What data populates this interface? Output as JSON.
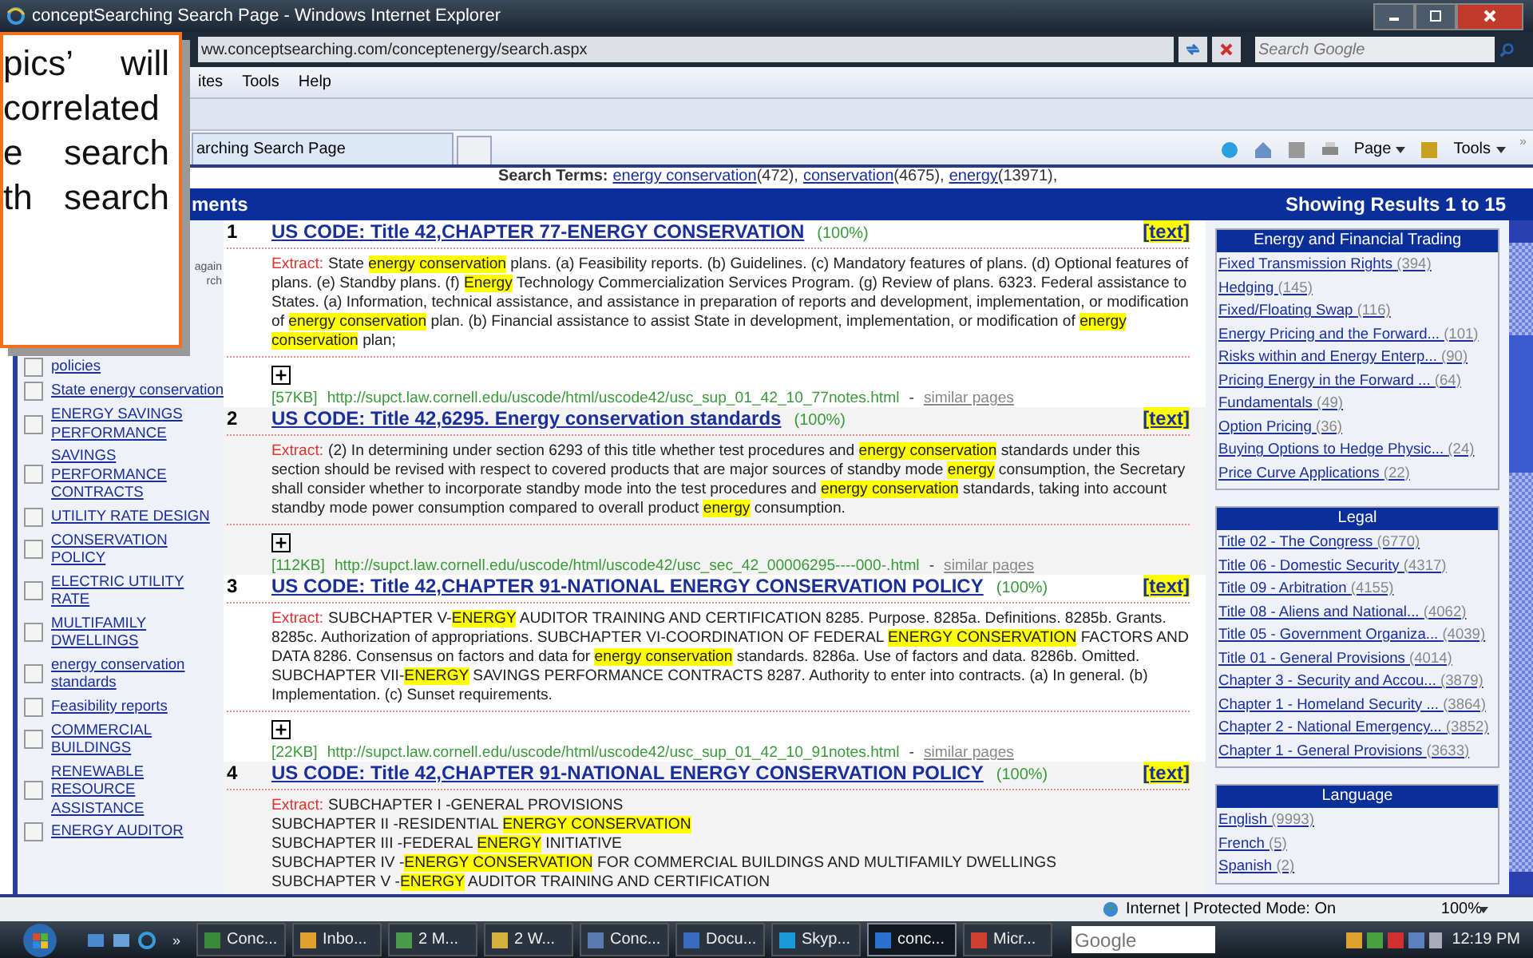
{
  "callout": {
    "lines": [
      "pics’ will",
      "correlated",
      "e search",
      "th search"
    ]
  },
  "window": {
    "title": "conceptSearching Search Page - Windows Internet Explorer"
  },
  "address_bar": {
    "url": "ww.conceptsearching.com/conceptenergy/search.aspx",
    "search_placeholder": "Search Google"
  },
  "menu": [
    "ites",
    "Tools",
    "Help"
  ],
  "tabs": [
    {
      "label": "arching Search Page",
      "selected": true
    }
  ],
  "command_bar": {
    "page": "Page",
    "tools": "Tools",
    "more": "»"
  },
  "search_terms": {
    "label": "Search Terms:",
    "terms": [
      {
        "term": "energy conservation",
        "count": "(472),"
      },
      {
        "term": "conservation",
        "count": "(4675),"
      },
      {
        "term": "energy",
        "count": "(13971),"
      }
    ]
  },
  "results_header": {
    "left": "ments",
    "right": "Showing Results 1 to 15"
  },
  "sidebar": {
    "note": [
      "again",
      "rch"
    ],
    "items": [
      {
        "label": "policies",
        "checked": false
      },
      {
        "label": "State energy conservation",
        "checked": false
      },
      {
        "label": "ENERGY SAVINGS PERFORMANCE",
        "checked": false
      },
      {
        "label": "SAVINGS PERFORMANCE CONTRACTS",
        "checked": false
      },
      {
        "label": "UTILITY RATE DESIGN",
        "checked": false
      },
      {
        "label": "CONSERVATION POLICY",
        "checked": false
      },
      {
        "label": "ELECTRIC UTILITY RATE",
        "checked": false
      },
      {
        "label": "MULTIFAMILY DWELLINGS",
        "checked": false
      },
      {
        "label": "energy conservation standards",
        "checked": false
      },
      {
        "label": "Feasibility reports",
        "checked": false
      },
      {
        "label": "COMMERCIAL BUILDINGS",
        "checked": false
      },
      {
        "label": "RENEWABLE RESOURCE ASSISTANCE",
        "checked": false
      },
      {
        "label": "ENERGY AUDITOR",
        "checked": false
      }
    ]
  },
  "results": [
    {
      "number": "1",
      "title": "US CODE: Title 42,CHAPTER 77-ENERGY CONSERVATION",
      "score": "(100%)",
      "text_link": "[text]",
      "extract_label": "Extract:",
      "extract": [
        "State **energy conservation** plans. (a) Feasibility reports. (b) Guidelines. (c) Mandatory features of plans. (d) Optional features of plans. (e) Standby plans. (f) **Energy** Technology Commercialization Services Program. (g) Review of plans. 6323. Federal assistance to States. (a) Information, technical assistance, and assistance in preparation of reports and development, implementation, or modification of **energy conservation** plan. (b) Financial assistance to assist State in development, implementation, or modification of **energy conservation** plan;"
      ],
      "size": "[57KB]",
      "url": "http://supct.law.cornell.edu/uscode/html/uscode42/usc_sup_01_42_10_77notes.html",
      "dash": "-",
      "similar": "similar pages"
    },
    {
      "number": "2",
      "title": "US CODE: Title 42,6295. Energy conservation standards",
      "score": "(100%)",
      "text_link": "[text]",
      "extract_label": "Extract:",
      "extract": [
        "(2) In determining under section 6293 of this title whether test procedures and **energy conservation** standards under this section should be revised with respect to covered products that are major sources of standby mode **energy** consumption, the Secretary shall consider whether to incorporate standby mode into the test procedures and **energy conservation** standards, taking into account standby mode power consumption compared to overall product **energy** consumption."
      ],
      "size": "[112KB]",
      "url": "http://supct.law.cornell.edu/uscode/html/uscode42/usc_sec_42_00006295----000-.html",
      "dash": "-",
      "similar": "similar pages"
    },
    {
      "number": "3",
      "title": "US CODE: Title 42,CHAPTER 91-NATIONAL ENERGY CONSERVATION POLICY",
      "score": "(100%)",
      "text_link": "[text]",
      "extract_label": "Extract:",
      "extract": [
        "SUBCHAPTER V-**ENERGY** AUDITOR TRAINING AND CERTIFICATION 8285. Purpose. 8285a. Definitions. 8285b. Grants. 8285c. Authorization of appropriations. SUBCHAPTER VI-COORDINATION OF FEDERAL **ENERGY CONSERVATION** FACTORS AND DATA 8286. Consensus on factors and data for **energy conservation** standards. 8286a. Use of factors and data. 8286b. Omitted. SUBCHAPTER VII-**ENERGY** SAVINGS PERFORMANCE CONTRACTS 8287. Authority to enter into contracts. (a) In general. (b) Implementation. (c) Sunset requirements."
      ],
      "size": "[22KB]",
      "url": "http://supct.law.cornell.edu/uscode/html/uscode42/usc_sup_01_42_10_91notes.html",
      "dash": "-",
      "similar": "similar pages"
    },
    {
      "number": "4",
      "title": "US CODE: Title 42,CHAPTER 91-NATIONAL ENERGY CONSERVATION POLICY",
      "score": "(100%)",
      "text_link": "[text]",
      "extract_label": "Extract:",
      "extract": [
        "SUBCHAPTER I -GENERAL PROVISIONS",
        "SUBCHAPTER II -RESIDENTIAL **ENERGY CONSERVATION**",
        "SUBCHAPTER III -FEDERAL **ENERGY** INITIATIVE",
        "SUBCHAPTER IV -**ENERGY CONSERVATION** FOR COMMERCIAL BUILDINGS AND MULTIFAMILY DWELLINGS",
        "SUBCHAPTER V -**ENERGY** AUDITOR TRAINING AND CERTIFICATION"
      ]
    }
  ],
  "facets": [
    {
      "title": "Energy and Financial Trading",
      "items": [
        {
          "label": "Fixed Transmission Rights",
          "count": "(394)"
        },
        {
          "label": "Hedging",
          "count": "(145)"
        },
        {
          "label": "Fixed/Floating Swap",
          "count": "(116)"
        },
        {
          "label": "Energy Pricing and the Forward...",
          "count": "(101)"
        },
        {
          "label": "Risks within and Energy Enterp...",
          "count": "(90)"
        },
        {
          "label": "Pricing Energy in the Forward ...",
          "count": "(64)"
        },
        {
          "label": "Fundamentals",
          "count": "(49)"
        },
        {
          "label": "Option Pricing",
          "count": "(36)"
        },
        {
          "label": "Buying Options to Hedge Physic...",
          "count": "(24)"
        },
        {
          "label": "Price Curve Applications",
          "count": "(22)"
        }
      ]
    },
    {
      "title": "Legal",
      "items": [
        {
          "label": "Title 02 - The Congress",
          "count": "(6770)"
        },
        {
          "label": "Title 06 - Domestic Security",
          "count": "(4317)"
        },
        {
          "label": "Title 09 - Arbitration",
          "count": "(4155)"
        },
        {
          "label": "Title 08 - Aliens and National...",
          "count": "(4062)"
        },
        {
          "label": "Title 05 - Government Organiza...",
          "count": "(4039)"
        },
        {
          "label": "Title 01 - General Provisions",
          "count": "(4014)"
        },
        {
          "label": "Chapter 3 - Security and Accou...",
          "count": "(3879)"
        },
        {
          "label": "Chapter 1 - Homeland Security ...",
          "count": "(3864)"
        },
        {
          "label": "Chapter 2 - National Emergency...",
          "count": "(3852)"
        },
        {
          "label": "Chapter 1 - General Provisions",
          "count": "(3633)"
        }
      ]
    },
    {
      "title": "Language",
      "items": [
        {
          "label": "English",
          "count": "(9993)"
        },
        {
          "label": "French",
          "count": "(5)"
        },
        {
          "label": "Spanish",
          "count": "(2)"
        }
      ]
    }
  ],
  "status_bar": {
    "zone": "Internet | Protected Mode: On",
    "zoom": "100%"
  },
  "taskbar": {
    "chevron": "»",
    "buttons": [
      {
        "label": "Conc...",
        "selected": false
      },
      {
        "label": "Inbo...",
        "selected": false
      },
      {
        "label": "2 M...",
        "selected": false
      },
      {
        "label": "2 W...",
        "selected": false
      },
      {
        "label": "Conc...",
        "selected": false
      },
      {
        "label": "Docu...",
        "selected": false
      },
      {
        "label": "Skyp...",
        "selected": false
      },
      {
        "label": "conc...",
        "selected": true
      },
      {
        "label": "Micr...",
        "selected": false
      }
    ],
    "search_placeholder": "Google",
    "clock": "12:19 PM"
  }
}
